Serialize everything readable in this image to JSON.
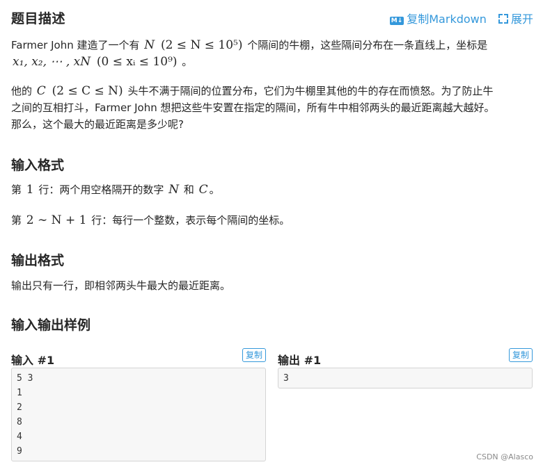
{
  "header": {
    "title": "题目描述",
    "copy_markdown_label": "复制Markdown",
    "md_badge": "M↓",
    "expand_label": "展开"
  },
  "description": {
    "p1_a": "Farmer John 建造了一个有",
    "p1_N": "N",
    "p1_range": "(2 ≤ N ≤ 10⁵)",
    "p1_b": "个隔间的牛棚，这些隔间分布在一条直线上，坐标是",
    "p1_coords": "x₁, x₂, ⋯ , xN",
    "p1_coord_range": "(0 ≤ xᵢ ≤ 10⁹)",
    "p1_end": "。",
    "p2_a": "他的",
    "p2_C": "C",
    "p2_range": "(2 ≤ C ≤ N)",
    "p2_b": "头牛不满于隔间的位置分布，它们为牛棚里其他的牛的存在而愤怒。为了防止牛",
    "p2_line2": "之间的互相打斗，Farmer John 想把这些牛安置在指定的隔间，所有牛中相邻两头的最近距离越大越好。",
    "p2_line3": "那么，这个最大的最近距离是多少呢?"
  },
  "input_format": {
    "title": "输入格式",
    "line1_a": "第",
    "line1_num": "1",
    "line1_b": "行：两个用空格隔开的数字",
    "line1_N": "N",
    "line1_and": "和",
    "line1_C": "C",
    "line1_end": "。",
    "line2_a": "第",
    "line2_range": "2 ∼ N + 1",
    "line2_b": "行：每行一个整数，表示每个隔间的坐标。"
  },
  "output_format": {
    "title": "输出格式",
    "text": "输出只有一行，即相邻两头牛最大的最近距离。"
  },
  "samples": {
    "title": "输入输出样例",
    "input_label": "输入 #1",
    "output_label": "输出 #1",
    "copy_label": "复制",
    "input_lines": [
      "5 3",
      "1",
      "2",
      "8",
      "4",
      "9"
    ],
    "output_lines": [
      "3"
    ]
  },
  "watermark": "CSDN @Alasco",
  "colors": {
    "link": "#3498db",
    "text": "#262626",
    "box_bg": "#f7f7f7",
    "box_border": "#d4d4d4"
  }
}
